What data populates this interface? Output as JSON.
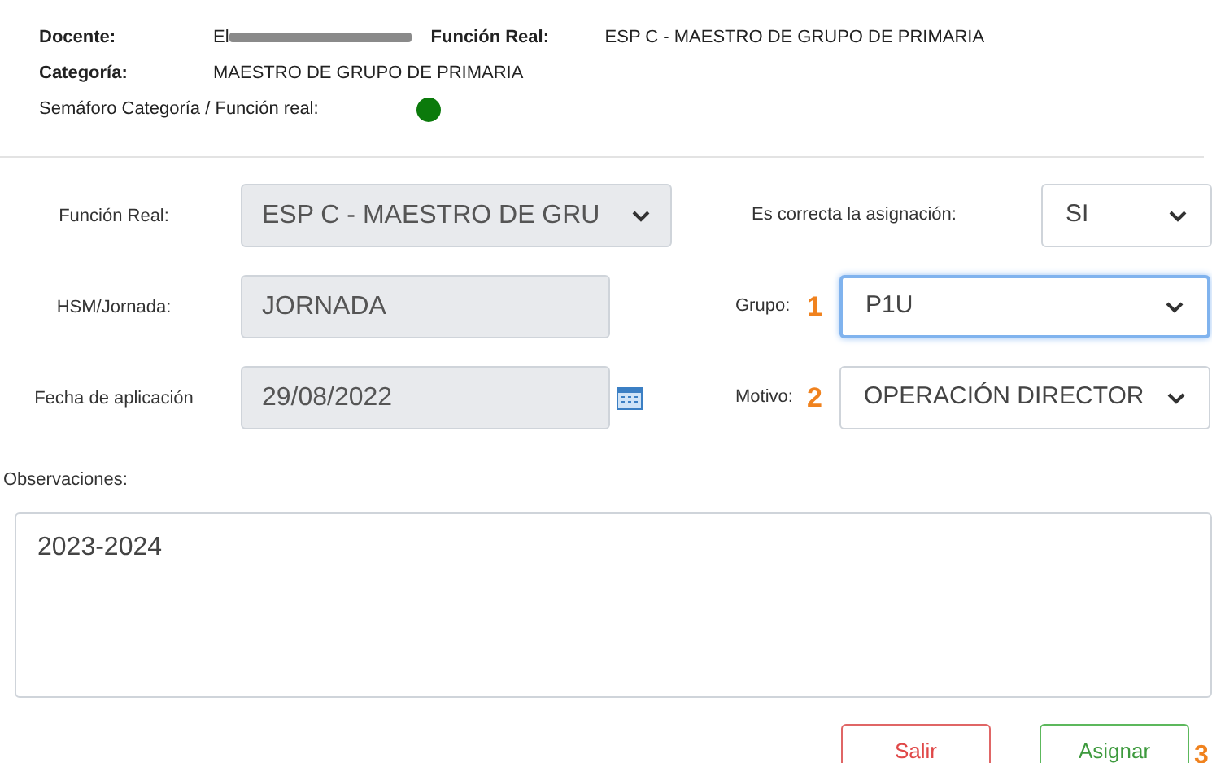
{
  "header": {
    "docente_label": "Docente:",
    "docente_value": "El",
    "docente_redacted": true,
    "funcion_label": "Función Real:",
    "funcion_value": "ESP C - MAESTRO DE GRUPO DE PRIMARIA",
    "categoria_label": "Categoría:",
    "categoria_value": "MAESTRO DE GRUPO DE PRIMARIA",
    "semaforo": {
      "label": "Semáforo Categoría / Función real:",
      "color": "#0b7a0b"
    }
  },
  "form": {
    "left": [
      {
        "kind": "select",
        "label": "Función Real:",
        "value": "ESP C - MAESTRO DE GRU",
        "disabled": true
      },
      {
        "kind": "input",
        "label": "HSM/Jornada:",
        "value": "JORNADA",
        "disabled": true
      },
      {
        "kind": "date",
        "label": "Fecha de aplicación",
        "value": "29/08/2022",
        "disabled": true
      }
    ],
    "right": [
      {
        "label": "Es correcta la asignación:",
        "value": "SI",
        "focused": false
      },
      {
        "label": "Grupo:",
        "marker": "1",
        "value": "P1U",
        "focused": true
      },
      {
        "label": "Motivo:",
        "marker": "2",
        "value": "OPERACIÓN DIRECTOR",
        "focused": false
      }
    ],
    "observaciones_label": "Observaciones:",
    "observaciones_value": "2023-2024"
  },
  "buttons": [
    {
      "kind": "cancel",
      "label": "Salir"
    },
    {
      "kind": "submit",
      "label": "Asignar",
      "marker": "3"
    }
  ]
}
